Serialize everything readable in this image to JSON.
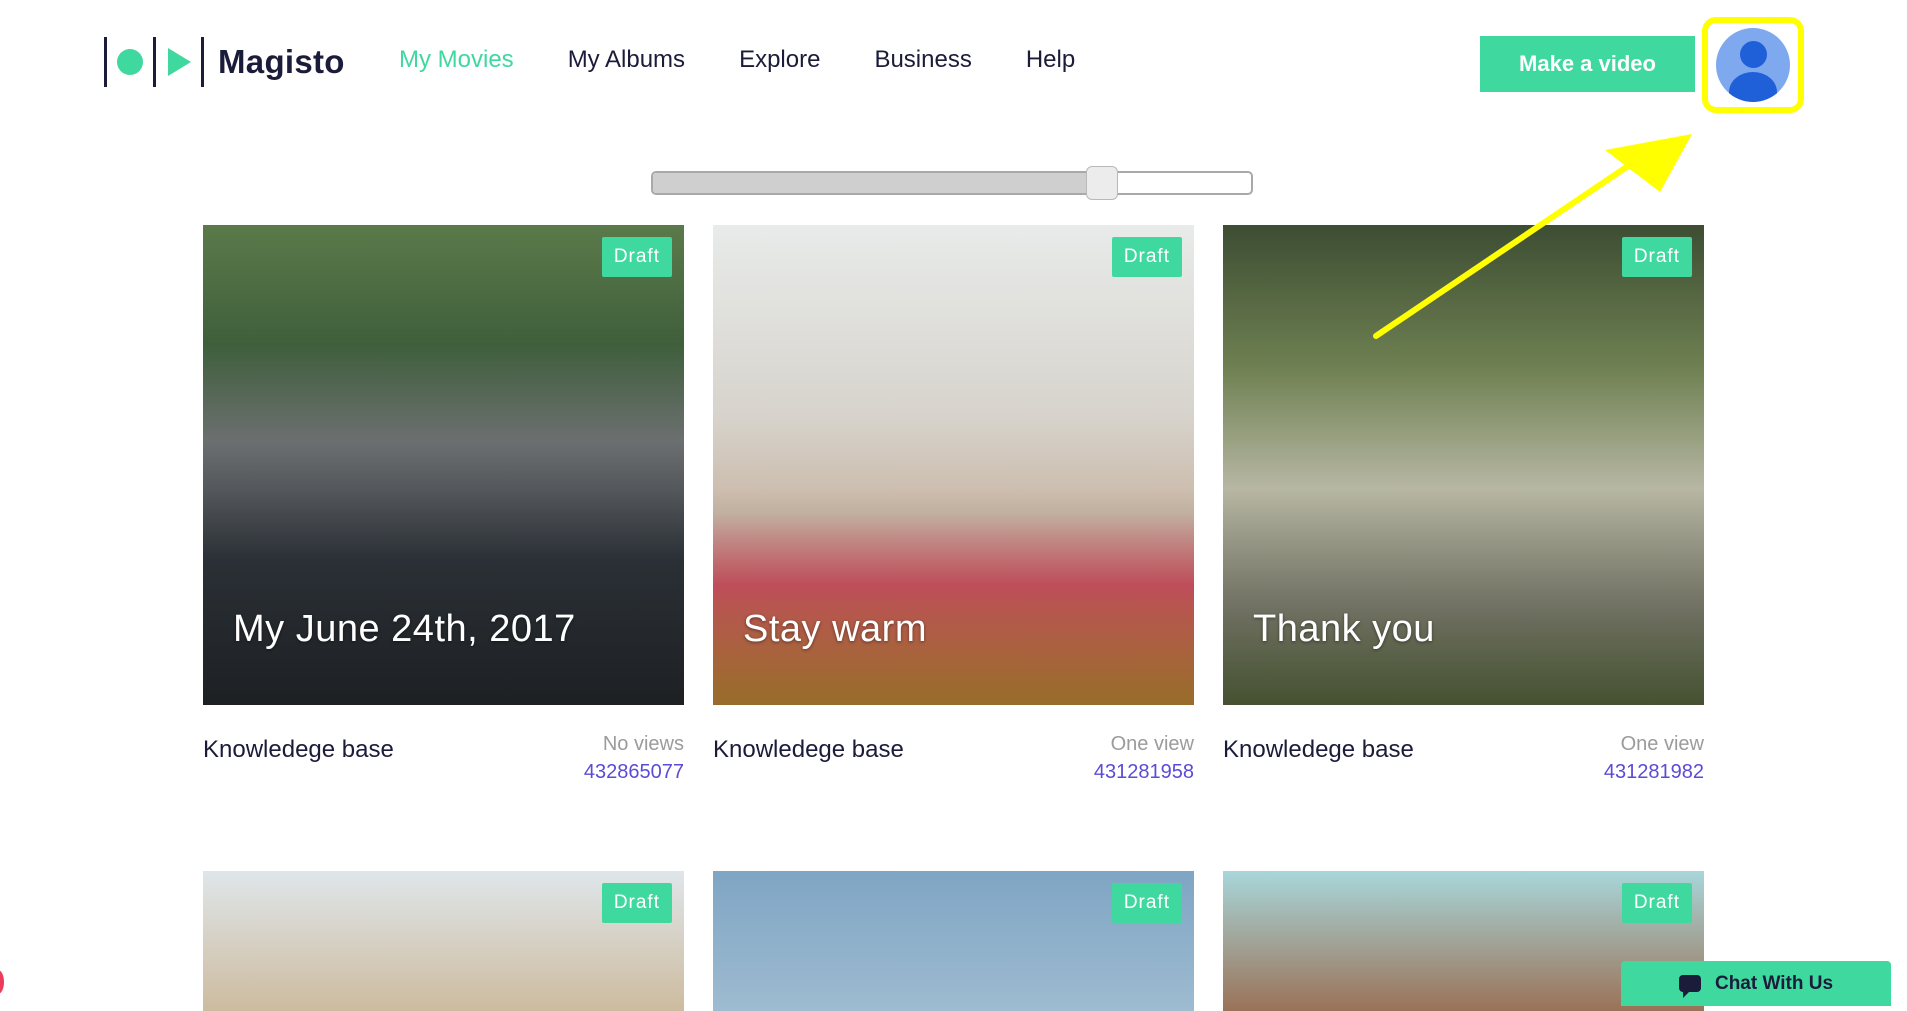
{
  "brand": {
    "name": "Magisto"
  },
  "nav": [
    {
      "label": "My Movies",
      "active": true
    },
    {
      "label": "My Albums",
      "active": false
    },
    {
      "label": "Explore",
      "active": false
    },
    {
      "label": "Business",
      "active": false
    },
    {
      "label": "Help",
      "active": false
    }
  ],
  "header": {
    "make_video_label": "Make a video"
  },
  "slider": {
    "value_fraction": 0.75
  },
  "movies": [
    {
      "title": "My June 24th, 2017",
      "badge": "Draft",
      "category": "Knowledege base",
      "views": "No views",
      "id": "432865077"
    },
    {
      "title": "Stay warm",
      "badge": "Draft",
      "category": "Knowledege base",
      "views": "One view",
      "id": "431281958"
    },
    {
      "title": "Thank you",
      "badge": "Draft",
      "category": "Knowledege base",
      "views": "One view",
      "id": "431281982"
    },
    {
      "badge": "Draft"
    },
    {
      "badge": "Draft"
    },
    {
      "badge": "Draft"
    }
  ],
  "chat": {
    "label": "Chat With Us"
  },
  "colors": {
    "accent": "#3fd9a0",
    "text": "#1b1b3a",
    "link": "#5b4bd5",
    "highlight": "#ffff00"
  },
  "icons": {
    "avatar": "user-avatar-icon",
    "chat": "chat-bubble-icon",
    "arrow": "annotation-arrow"
  }
}
